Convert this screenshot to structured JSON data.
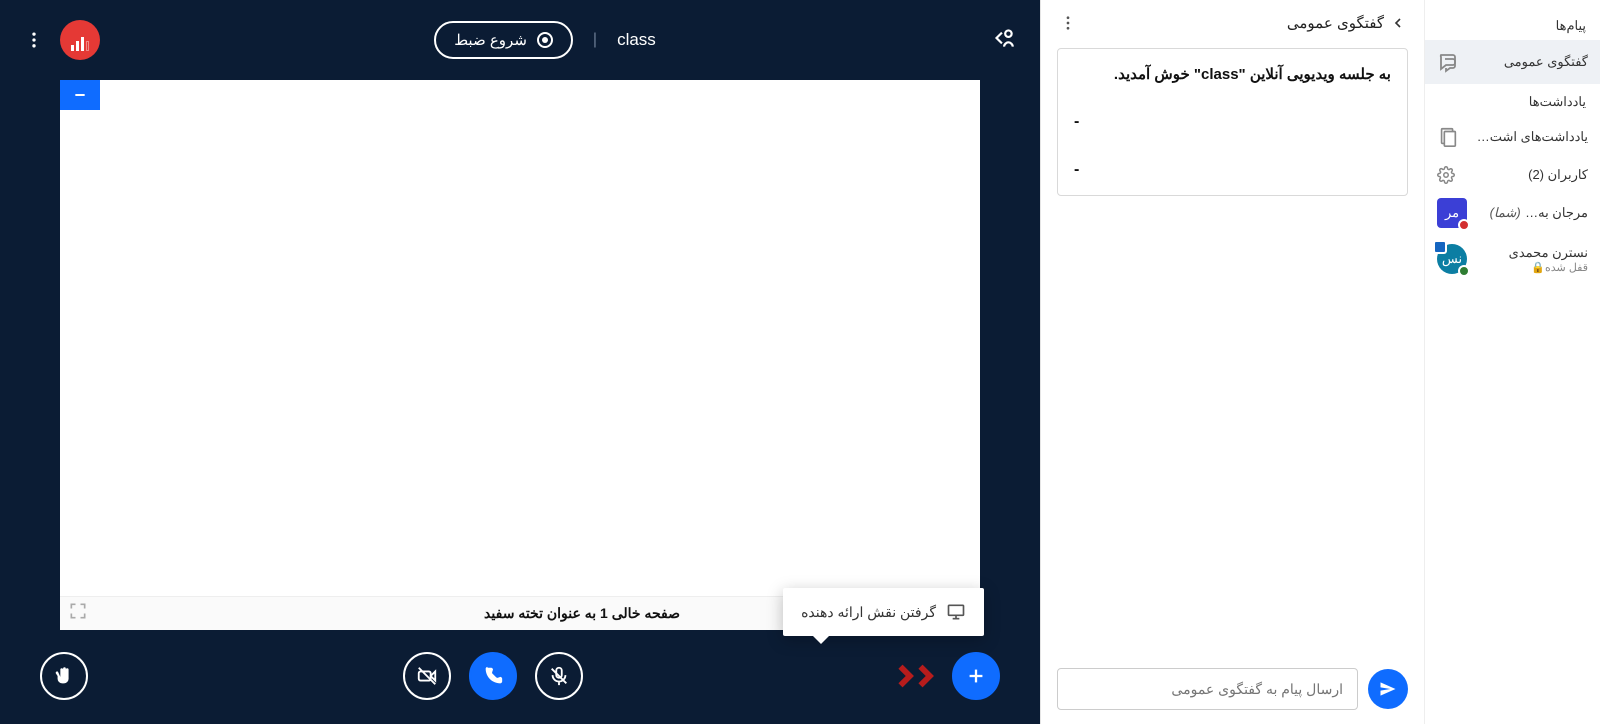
{
  "sidebar": {
    "messages_title": "پیام‌ها",
    "public_chat": "گفتگوی عمومی",
    "notes_title": "یادداشت‌ها",
    "shared_notes": "یادداشت‌های اشت…",
    "users_title": "کاربران (2)"
  },
  "users": [
    {
      "name": "مرجان به…",
      "you": "(شما)",
      "sub": "",
      "avatar_text": "مر",
      "avatar_color": "blue",
      "badge": "red"
    },
    {
      "name": "نسترن محمدی",
      "you": "",
      "sub": "قفل شده🔒",
      "avatar_text": "نس",
      "avatar_color": "cyan",
      "badge": "blue-green"
    }
  ],
  "chat": {
    "header": "گفتگوی عمومی",
    "welcome": "به جلسه ویدیویی آنلاین \"class\" خوش آمدید.",
    "dash": "-",
    "input_placeholder": "ارسال پیام به گفتگوی عمومی"
  },
  "main": {
    "record_label": "شروع ضبط",
    "title": "class",
    "slide_label": "صفحه خالی 1 به عنوان تخته سفید",
    "tooltip": "گرفتن نقش ارائه دهنده"
  }
}
